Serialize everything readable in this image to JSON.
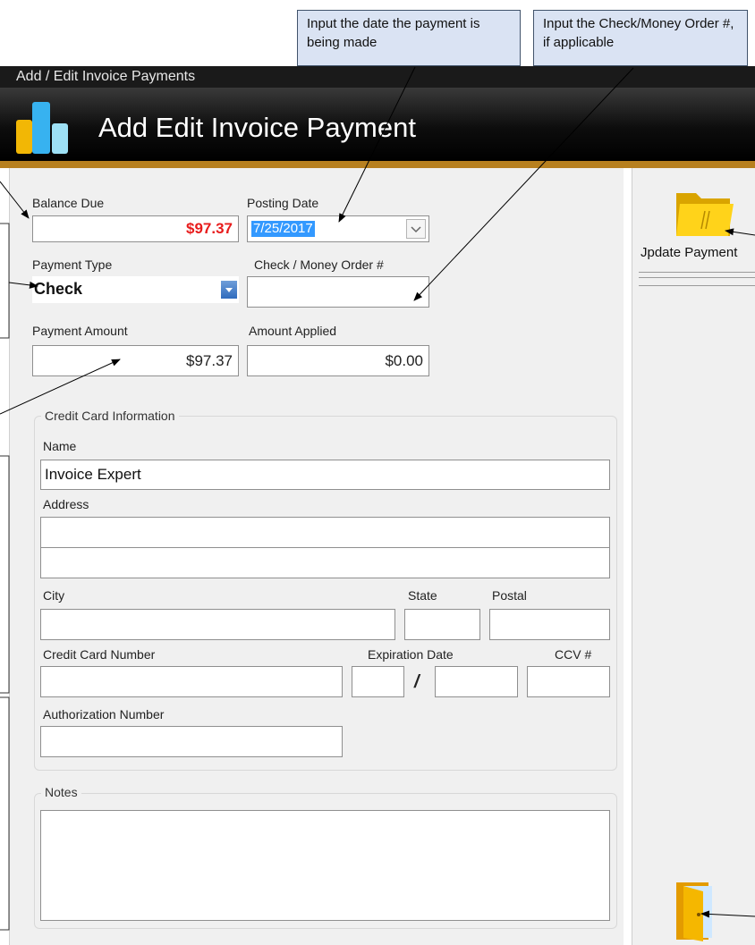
{
  "callouts": {
    "date": "Input the date the payment is being made",
    "check": "Input the Check/Money Order #, if applicable"
  },
  "window": {
    "title": "Add / Edit Invoice Payments",
    "header": "Add Edit Invoice Payment"
  },
  "form": {
    "balance_due_label": "Balance Due",
    "balance_due_value": "$97.37",
    "posting_date_label": "Posting Date",
    "posting_date_value": "7/25/2017",
    "payment_type_label": "Payment Type",
    "payment_type_value": "Check",
    "check_label": "Check / Money Order #",
    "check_value": "",
    "payment_amount_label": "Payment Amount",
    "payment_amount_value": "$97.37",
    "amount_applied_label": "Amount Applied",
    "amount_applied_value": "$0.00"
  },
  "credit_card": {
    "legend": "Credit Card Information",
    "name_label": "Name",
    "name_value": "Invoice Expert",
    "address_label": "Address",
    "city_label": "City",
    "state_label": "State",
    "postal_label": "Postal",
    "card_number_label": "Credit Card Number",
    "expiration_label": "Expiration Date",
    "expiration_separator": "/",
    "ccv_label": "CCV #",
    "auth_label": "Authorization Number"
  },
  "notes": {
    "legend": "Notes"
  },
  "sidebar": {
    "update_label": "Jpdate Payment"
  },
  "colors": {
    "balance_due": "#e81c1c",
    "accent": "#b7801f",
    "callout_bg": "#dae3f3"
  }
}
